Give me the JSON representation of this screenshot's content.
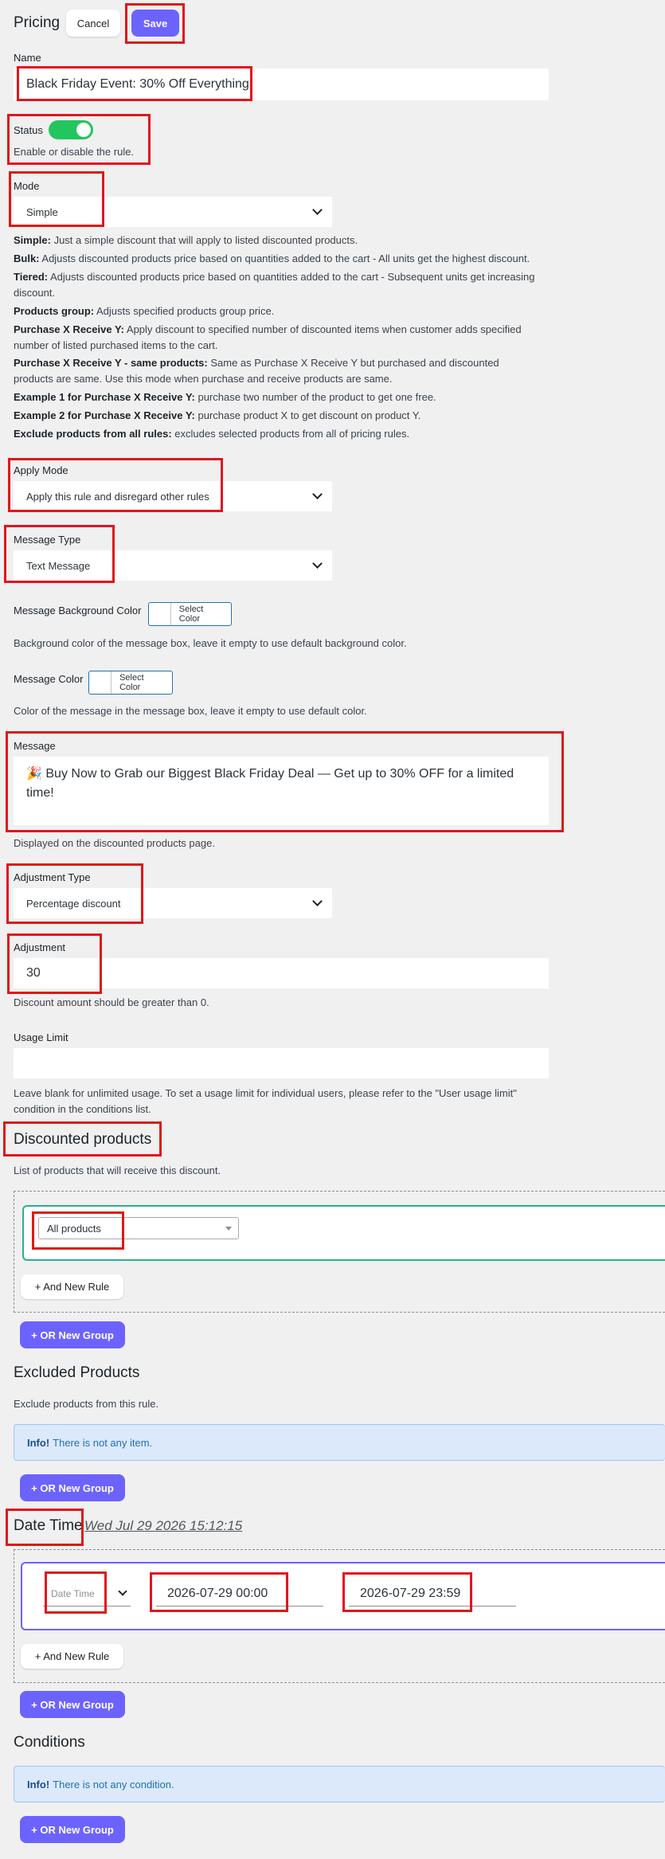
{
  "header": {
    "title": "Pricing",
    "cancel_label": "Cancel",
    "save_label": "Save"
  },
  "name": {
    "label": "Name",
    "value": "Black Friday Event: 30% Off Everything"
  },
  "status": {
    "label": "Status",
    "enabled": true,
    "description": "Enable or disable the rule."
  },
  "mode": {
    "label": "Mode",
    "value": "Simple",
    "descriptions": [
      {
        "term": "Simple:",
        "text": " Just a simple discount that will apply to listed discounted products."
      },
      {
        "term": "Bulk:",
        "text": " Adjusts discounted products price based on quantities added to the cart - All units get the highest discount."
      },
      {
        "term": "Tiered:",
        "text": " Adjusts discounted products price based on quantities added to the cart - Subsequent units get increasing discount."
      },
      {
        "term": "Products group:",
        "text": " Adjusts specified products group price."
      },
      {
        "term": "Purchase X Receive Y:",
        "text": " Apply discount to specified number of discounted items when customer adds specified number of listed purchased items to the cart."
      },
      {
        "term": "Purchase X Receive Y - same products:",
        "text": " Same as Purchase X Receive Y but purchased and discounted products are same. Use this mode when purchase and receive products are same."
      },
      {
        "term": "Example 1 for Purchase X Receive Y:",
        "text": " purchase two number of the product to get one free."
      },
      {
        "term": "Example 2 for Purchase X Receive Y:",
        "text": " purchase product X to get discount on product Y."
      },
      {
        "term": "Exclude products from all rules:",
        "text": " excludes selected products from all of pricing rules."
      }
    ]
  },
  "apply_mode": {
    "label": "Apply Mode",
    "value": "Apply this rule and disregard other rules"
  },
  "message_type": {
    "label": "Message Type",
    "value": "Text Message"
  },
  "message_bg_color": {
    "label": "Message Background Color",
    "button": "Select Color",
    "description": "Background color of the message box, leave it empty to use default background color."
  },
  "message_color": {
    "label": "Message Color",
    "button": "Select Color",
    "description": "Color of the message in the message box, leave it empty to use default color."
  },
  "message": {
    "label": "Message",
    "value": "🎉 Buy Now to Grab our Biggest Black Friday Deal — Get up to 30% OFF for a limited time!",
    "description": "Displayed on the discounted products page."
  },
  "adjustment_type": {
    "label": "Adjustment Type",
    "value": "Percentage discount"
  },
  "adjustment": {
    "label": "Adjustment",
    "value": "30",
    "description": "Discount amount should be greater than 0."
  },
  "usage_limit": {
    "label": "Usage Limit",
    "value": "",
    "description": "Leave blank for unlimited usage. To set a usage limit for individual users, please refer to the \"User usage limit\" condition in the conditions list."
  },
  "discounted_products": {
    "title": "Discounted products",
    "description": "List of products that will receive this discount.",
    "rule_value": "All products",
    "and_rule": "+ And New Rule",
    "or_group": "+ OR New Group"
  },
  "excluded_products": {
    "title": "Excluded Products",
    "description": "Exclude products from this rule.",
    "info_bold": "Info!",
    "info_text": "There is not any item.",
    "or_group": "+ OR New Group"
  },
  "date_time": {
    "title": "Date Time",
    "current": "Wed Jul 29 2026 15:12:15",
    "type_value": "Date Time",
    "from": "2026-07-29 00:00",
    "to": "2026-07-29 23:59",
    "and_rule": "+ And New Rule",
    "or_group": "+ OR New Group"
  },
  "conditions": {
    "title": "Conditions",
    "info_bold": "Info!",
    "info_text": "There is not any condition.",
    "or_group": "+ OR New Group"
  },
  "colors": {
    "accent": "#6c63ff",
    "toggle_on": "#22c55e",
    "highlight": "#e0161b",
    "rule_border": "#2ab08a",
    "date_border": "#6c63ff"
  }
}
